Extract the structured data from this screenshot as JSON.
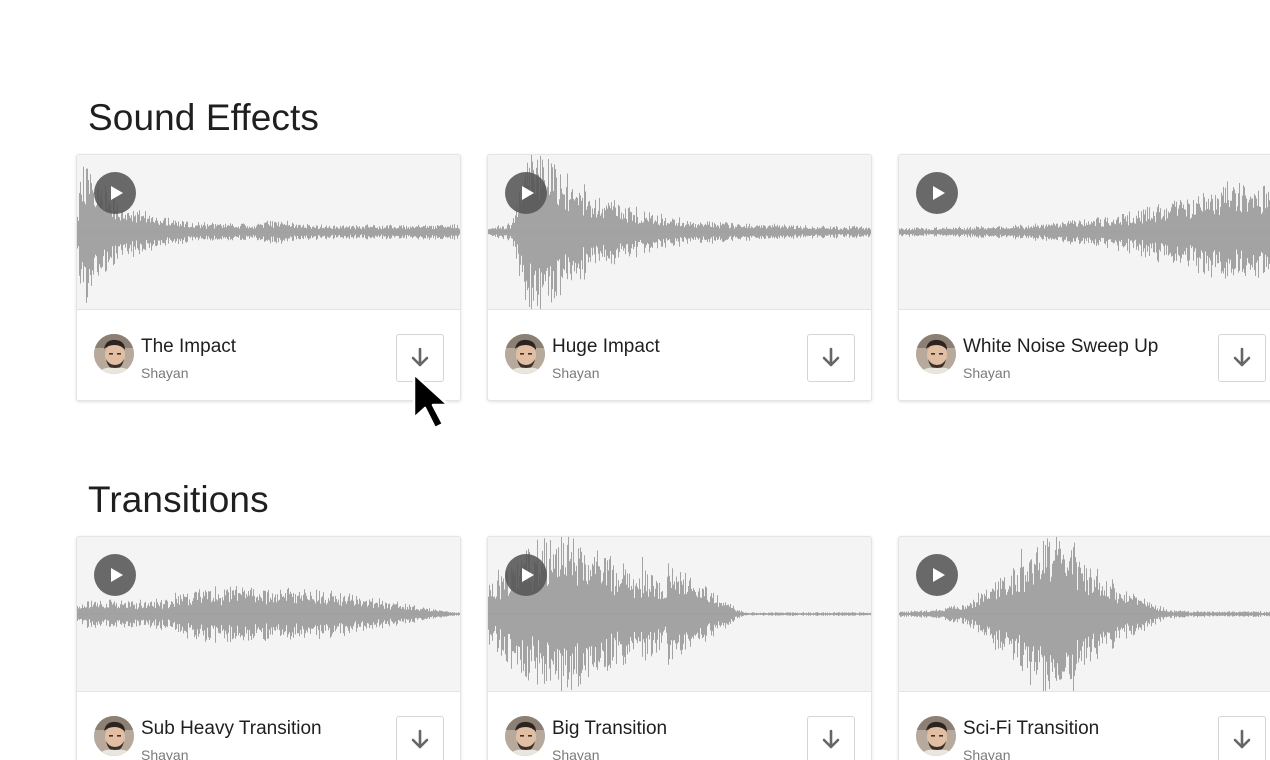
{
  "sections": [
    {
      "title": "Sound Effects",
      "tracks": [
        {
          "title": "The Impact",
          "author": "Shayan",
          "waveform": "impact-early"
        },
        {
          "title": "Huge Impact",
          "author": "Shayan",
          "waveform": "impact-late"
        },
        {
          "title": "White Noise Sweep Up",
          "author": "Shayan",
          "waveform": "sweep-up"
        }
      ]
    },
    {
      "title": "Transitions",
      "tracks": [
        {
          "title": "Sub Heavy Transition",
          "author": "Shayan",
          "waveform": "sub-heavy"
        },
        {
          "title": "Big Transition",
          "author": "Shayan",
          "waveform": "big-transition"
        },
        {
          "title": "Sci-Fi Transition",
          "author": "Shayan",
          "waveform": "scifi"
        }
      ]
    }
  ],
  "icons": {
    "play": "play-icon",
    "download": "download-arrow-icon",
    "cursor": "mouse-pointer-icon"
  },
  "colors": {
    "waveform": "#9b9b9b",
    "wave_background": "#f4f4f4",
    "play_button": "#555555",
    "download_arrow": "#666666"
  }
}
